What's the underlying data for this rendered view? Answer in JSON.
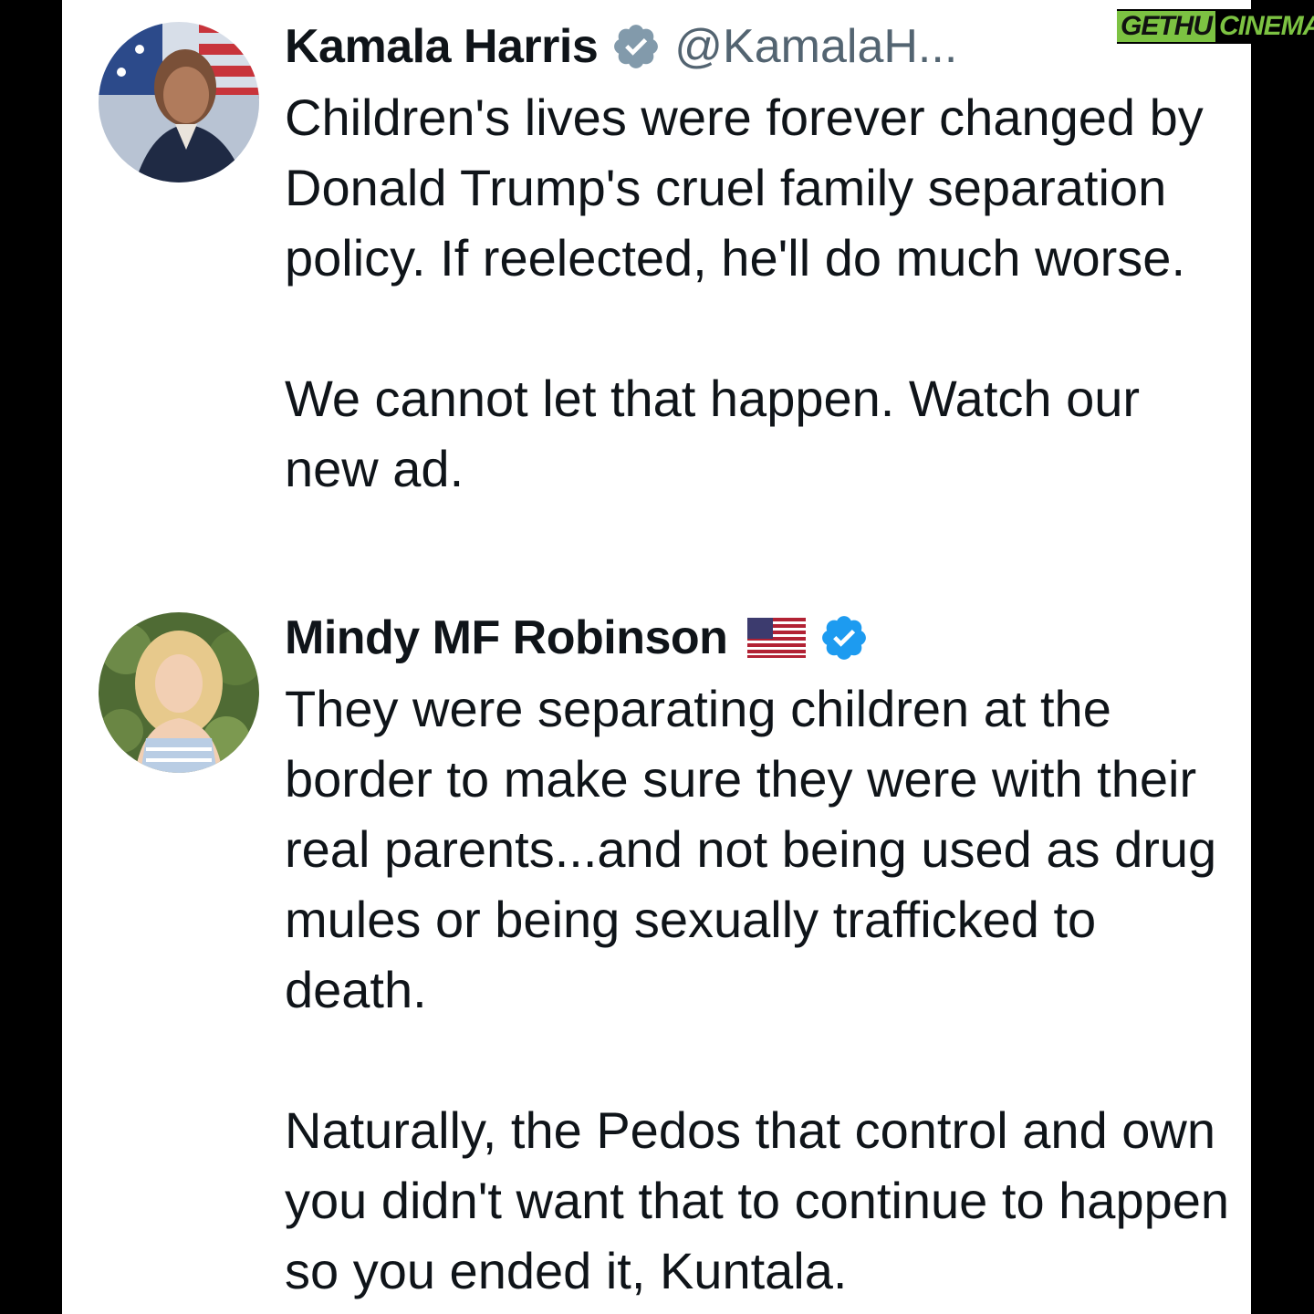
{
  "watermark": {
    "part1": "GETHU",
    "part2": "CINEMA",
    "color": "#7cc242"
  },
  "tweets": [
    {
      "name": "Kamala Harris",
      "badge": "gray-verified-badge-icon",
      "handle": "@KamalaH...",
      "paragraphs": [
        "Children's lives were forever changed by Donald Trump's cruel family separation policy. If reelected, he'll do much worse.",
        "We cannot let that happen. Watch our new ad."
      ]
    },
    {
      "name": "Mindy MF Robinson",
      "flag": "us-flag-icon",
      "badge": "blue-verified-badge-icon",
      "paragraphs": [
        "They were separating children at the border to make sure they were with their real parents...and not being used as drug mules or being sexually trafficked to death.",
        "Naturally, the Pedos that control and own you didn't want that to continue to happen so you ended it, Kuntala."
      ]
    }
  ],
  "colors": {
    "text": "#0f1419",
    "muted": "#536471",
    "gray_badge": "#829aab",
    "blue_badge": "#1d9bf0"
  }
}
